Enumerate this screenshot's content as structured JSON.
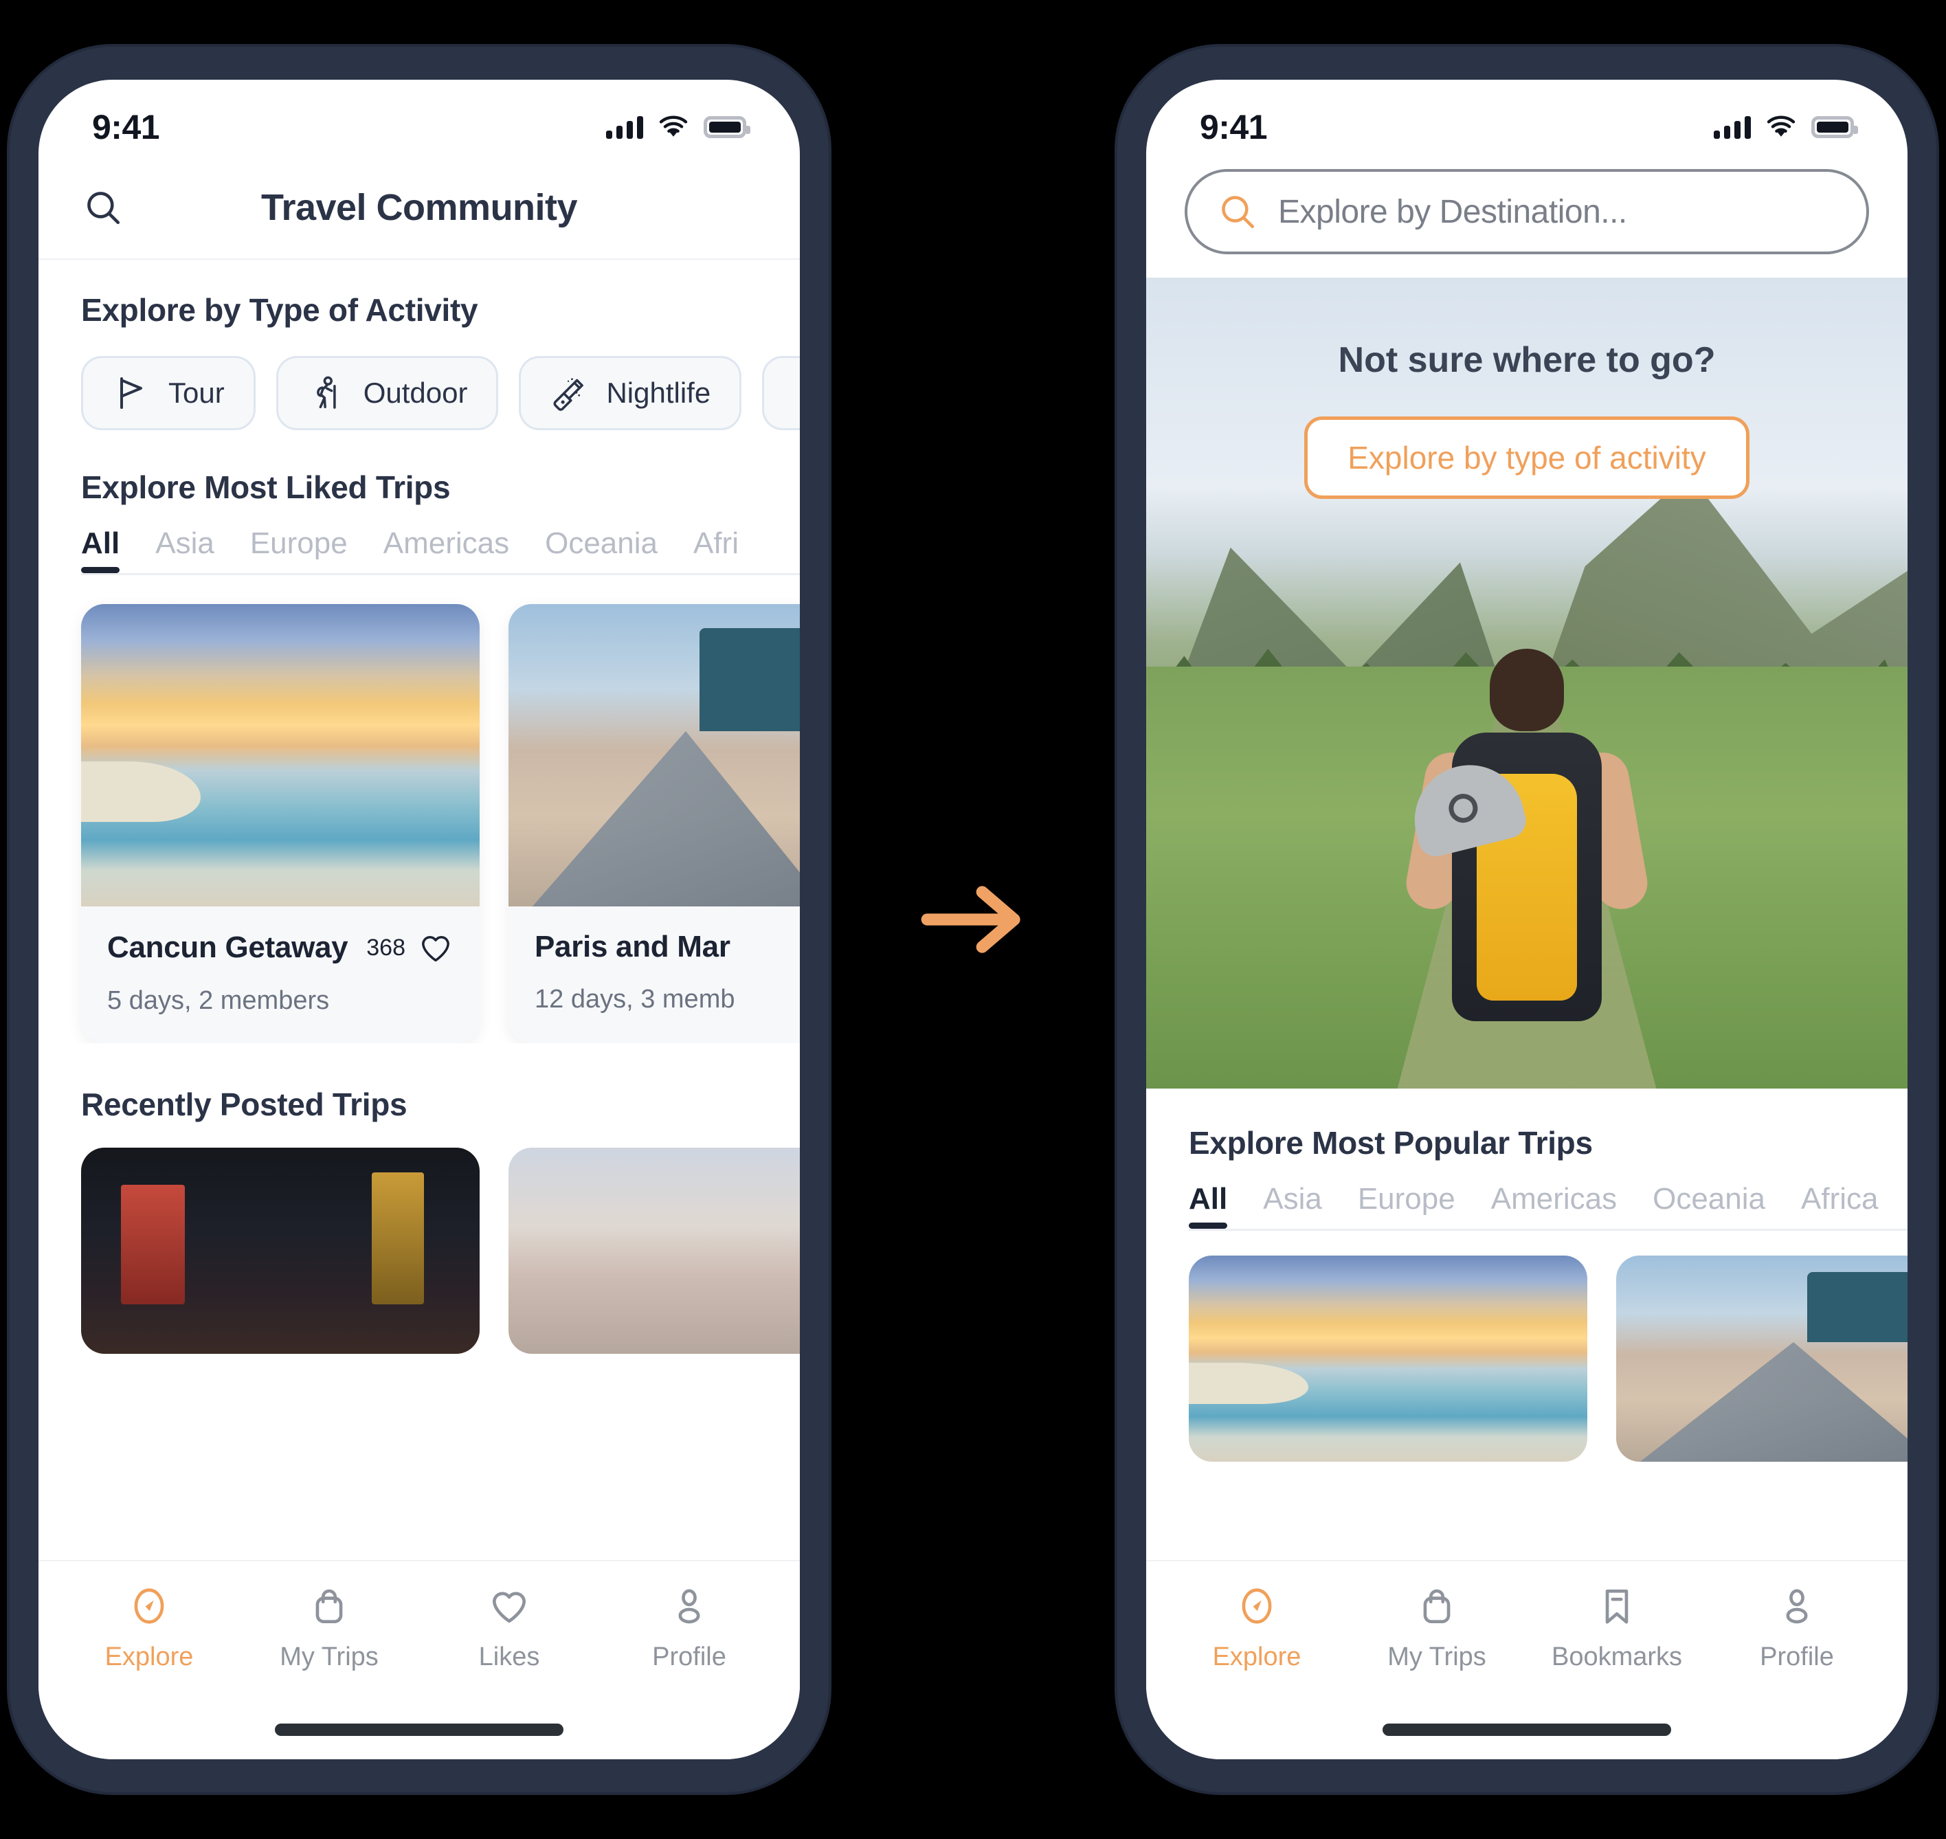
{
  "accent": "#f0a05a",
  "frame_color": "#2b3347",
  "status_bar": {
    "time": "9:41",
    "signal_icon": "cellular-signal-icon",
    "wifi_icon": "wifi-icon",
    "battery_icon": "battery-icon"
  },
  "left_phone": {
    "header": {
      "search_icon": "search-icon",
      "title": "Travel Community"
    },
    "activity_section": {
      "title": "Explore by Type of Activity",
      "chips": [
        {
          "label": "Tour",
          "icon": "flag-icon"
        },
        {
          "label": "Outdoor",
          "icon": "hiker-icon"
        },
        {
          "label": "Nightlife",
          "icon": "champagne-bottle-icon"
        },
        {
          "label": "",
          "icon": "partial-chip"
        }
      ]
    },
    "liked_section": {
      "title": "Explore Most Liked Trips",
      "tabs": [
        "All",
        "Asia",
        "Europe",
        "Americas",
        "Oceania",
        "Afri"
      ],
      "active_tab": "All",
      "cards": [
        {
          "title": "Cancun Getaway",
          "likes": "368",
          "like_icon": "heart-icon",
          "sub": "5 days, 2 members",
          "photo": "beach-sunset"
        },
        {
          "title": "Paris and Mar",
          "likes": "",
          "like_icon": "heart-icon",
          "sub": "12 days, 3 memb",
          "photo": "louvre-pyramid"
        }
      ]
    },
    "recent_section": {
      "title": "Recently Posted Trips",
      "cards": [
        {
          "photo": "tokyo-night-street"
        },
        {
          "photo": "city-dusk"
        }
      ]
    },
    "bottom_nav": {
      "items": [
        {
          "label": "Explore",
          "icon": "compass-icon",
          "active": true
        },
        {
          "label": "My Trips",
          "icon": "bag-icon",
          "active": false
        },
        {
          "label": "Likes",
          "icon": "heart-icon",
          "active": false
        },
        {
          "label": "Profile",
          "icon": "person-icon",
          "active": false
        }
      ]
    }
  },
  "right_phone": {
    "search": {
      "placeholder": "Explore by Destination...",
      "icon": "search-icon"
    },
    "hero": {
      "question": "Not sure where to go?",
      "button_label": "Explore by type of activity",
      "image": "hiker-with-yellow-backpack-in-mountain-meadow"
    },
    "popular_section": {
      "title": "Explore Most Popular Trips",
      "tabs": [
        "All",
        "Asia",
        "Europe",
        "Americas",
        "Oceania",
        "Africa"
      ],
      "active_tab": "All",
      "cards": [
        {
          "photo": "beach-sunset"
        },
        {
          "photo": "louvre-pyramid"
        }
      ]
    },
    "bottom_nav": {
      "items": [
        {
          "label": "Explore",
          "icon": "compass-icon",
          "active": true
        },
        {
          "label": "My Trips",
          "icon": "bag-icon",
          "active": false
        },
        {
          "label": "Bookmarks",
          "icon": "bookmark-icon",
          "active": false
        },
        {
          "label": "Profile",
          "icon": "person-icon",
          "active": false
        }
      ]
    }
  },
  "transition_arrow": {
    "icon": "arrow-right-icon"
  }
}
